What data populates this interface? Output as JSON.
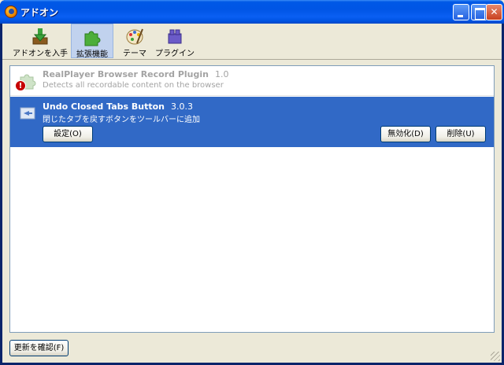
{
  "window": {
    "title": "アドオン",
    "controls": {
      "minimize": "minimize-icon",
      "maximize": "maximize-icon",
      "close": "close-icon"
    }
  },
  "toolbar": {
    "items": [
      {
        "label": "アドオンを入手",
        "icon": "get-addons-icon"
      },
      {
        "label": "拡張機能",
        "icon": "extensions-icon",
        "selected": true
      },
      {
        "label": "テーマ",
        "icon": "themes-icon"
      },
      {
        "label": "プラグイン",
        "icon": "plugins-icon"
      }
    ]
  },
  "extensions": [
    {
      "name": "RealPlayer Browser Record Plugin",
      "version": "1.0",
      "description": "Detects all recordable content on the browser",
      "disabled": true
    },
    {
      "name": "Undo Closed Tabs Button",
      "version": "3.0.3",
      "description": "閉じたタブを戻すボタンをツールバーに追加",
      "selected": true,
      "buttons": {
        "options": "設定(O)",
        "disable": "無効化(D)",
        "uninstall": "削除(U)"
      }
    }
  ],
  "footer": {
    "check_updates": "更新を確認(F)"
  },
  "colors": {
    "selection": "#3169c6",
    "titlebar": "#0054e3"
  }
}
